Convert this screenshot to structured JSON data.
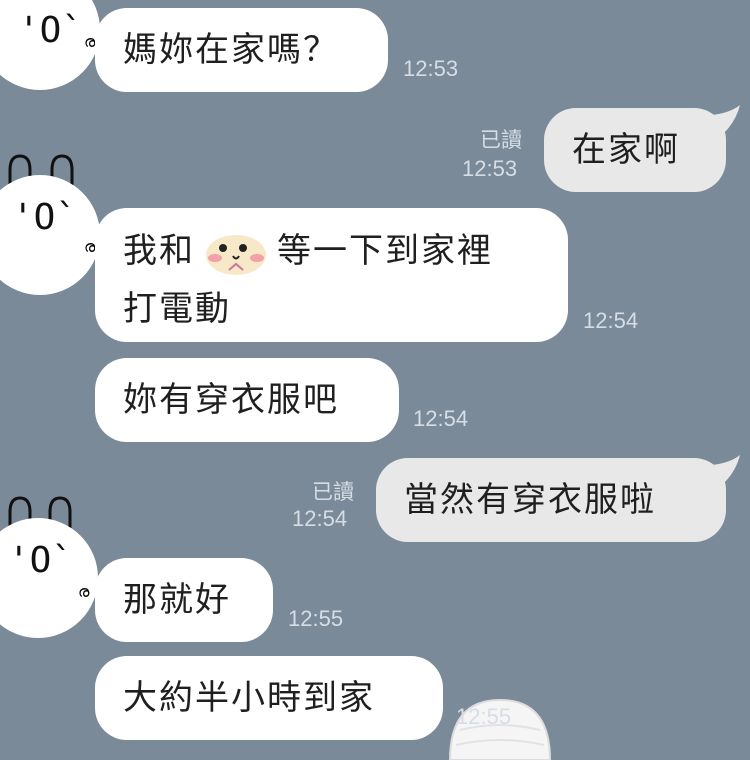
{
  "messages": [
    {
      "id": "m1",
      "side": "in",
      "text": "媽妳在家嗎？",
      "time": "12:53"
    },
    {
      "id": "m2",
      "side": "out",
      "text": "在家啊",
      "time": "12:53",
      "read": "已讀"
    },
    {
      "id": "m3",
      "side": "in",
      "text_before": "我和",
      "text_after": "等一下到家裡",
      "text_line2": "打電動",
      "time": "12:54"
    },
    {
      "id": "m4",
      "side": "in",
      "text": "妳有穿衣服吧",
      "time": "12:54"
    },
    {
      "id": "m5",
      "side": "out",
      "text": "當然有穿衣服啦",
      "time": "12:54",
      "read": "已讀"
    },
    {
      "id": "m6",
      "side": "in",
      "text": "那就好",
      "time": "12:55"
    },
    {
      "id": "m7",
      "side": "in",
      "text": "大約半小時到家",
      "time": "12:55"
    }
  ],
  "avatar": {
    "face": "´O`",
    "swirl": "ര"
  },
  "colors": {
    "background": "#7a8a99",
    "incoming": "#ffffff",
    "outgoing": "#e8e8e8",
    "meta": "#d6dde4"
  },
  "icons": {
    "inline_sticker": "pink-blob-sticker-icon",
    "avatar": "bunny-avatar-icon"
  }
}
